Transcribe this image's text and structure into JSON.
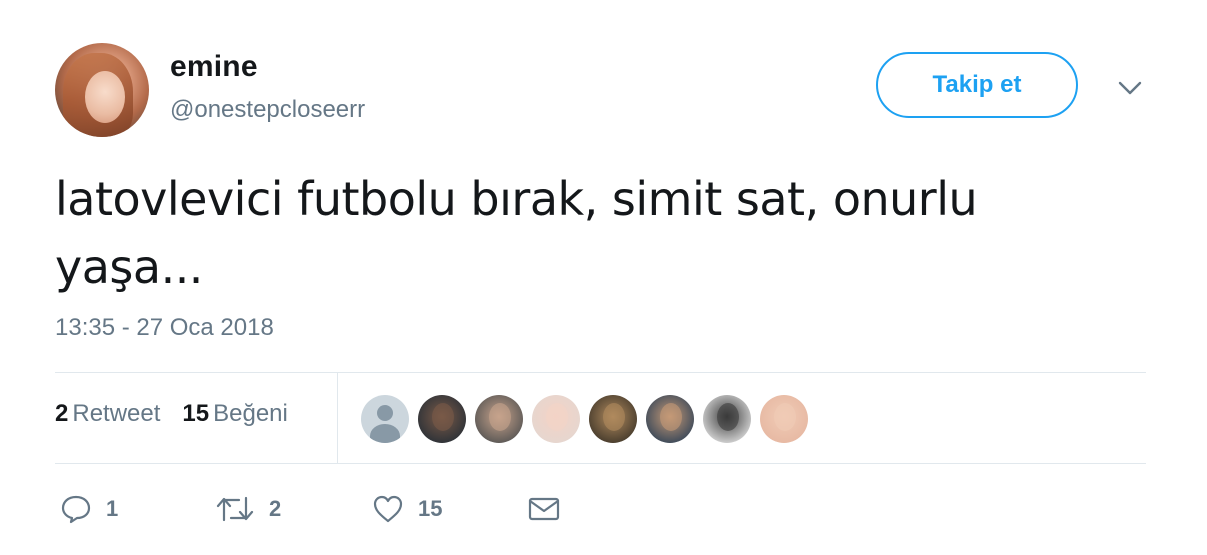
{
  "author": {
    "display_name": "emine",
    "handle": "@onestepcloseerr",
    "avatar_icon": "user-avatar-photo"
  },
  "header": {
    "follow_label": "Takip et",
    "menu_icon": "chevron-down-icon"
  },
  "tweet": {
    "text": "latovlevici futbolu bırak, simit sat, onurlu yaşa...",
    "timestamp": "13:35 - 27 Oca 2018"
  },
  "stats": {
    "retweet_count": "2",
    "retweet_label": "Retweet",
    "like_count": "15",
    "like_label": "Beğeni"
  },
  "likers": [
    {
      "kind": "default",
      "color": "#ccd6dd"
    },
    {
      "kind": "photo",
      "bg": "#2f3338",
      "fg": "#7a5a48"
    },
    {
      "kind": "photo",
      "bg": "#5e5a57",
      "fg": "#c7a38c"
    },
    {
      "kind": "photo",
      "bg": "#e6d6cf",
      "fg": "#f3d3c6"
    },
    {
      "kind": "photo",
      "bg": "#4a3e2e",
      "fg": "#b08a5e"
    },
    {
      "kind": "photo",
      "bg": "#3f4b5a",
      "fg": "#c59a77"
    },
    {
      "kind": "photo",
      "bg": "#cfcfcf",
      "fg": "#3a3a3a"
    },
    {
      "kind": "photo",
      "bg": "#e7b9a3",
      "fg": "#f0cbb6"
    }
  ],
  "actions": {
    "reply_count": "1",
    "retweet_count": "2",
    "like_count": "15"
  },
  "colors": {
    "accent": "#1da1f2",
    "secondary_text": "#657786",
    "primary_text": "#14171a",
    "divider": "#e1e8ed"
  }
}
